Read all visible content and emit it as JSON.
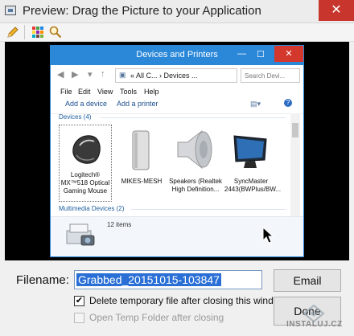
{
  "window": {
    "title": "Preview: Drag the Picture to your Application",
    "close_label": "✕",
    "app_icon": "picture-icon"
  },
  "toolbar": {
    "icons": [
      "pencil-icon",
      "palette-grid-icon",
      "magnifier-icon"
    ]
  },
  "preview": {
    "inner_window": {
      "title": "Devices and Printers",
      "controls": {
        "minimize": "—",
        "maximize": "☐",
        "close": "✕"
      },
      "address": "« All C... › Devices ...",
      "search_placeholder": "Search Devi...",
      "menu": [
        "File",
        "Edit",
        "View",
        "Tools",
        "Help"
      ],
      "commands": {
        "add_device": "Add a device",
        "add_printer": "Add a printer"
      },
      "groups": {
        "devices": "Devices (4)",
        "multimedia": "Multimedia Devices (2)"
      },
      "devices": [
        {
          "line1": "Logitech®",
          "line2": "MX™518 Optical",
          "line3": "Gaming Mouse",
          "icon": "mouse-icon"
        },
        {
          "line1": "MIKES-MESH",
          "line2": "",
          "line3": "",
          "icon": "computer-tower-icon"
        },
        {
          "line1": "Speakers (Realtek",
          "line2": "High Definition...",
          "line3": "",
          "icon": "speaker-icon"
        },
        {
          "line1": "SyncMaster",
          "line2": "2443(BWPlus/BW...",
          "line3": "",
          "icon": "monitor-icon"
        }
      ],
      "details": {
        "items_count": "12 items"
      }
    }
  },
  "form": {
    "filename_label": "Filename:",
    "filename_value": "Grabbed_20151015-103847",
    "checkbox_delete_label": "Delete temporary file after closing this window",
    "checkbox_delete_checked": true,
    "checkbox_open_label": "Open Temp Folder after closing",
    "checkbox_open_checked": false,
    "email_button": "Email",
    "done_button": "Done"
  },
  "watermark": {
    "text": "INSTALUJ.CZ"
  },
  "colors": {
    "accent_blue": "#2b88d9",
    "close_red": "#c7352c",
    "selection_blue": "#2a6fd6"
  }
}
